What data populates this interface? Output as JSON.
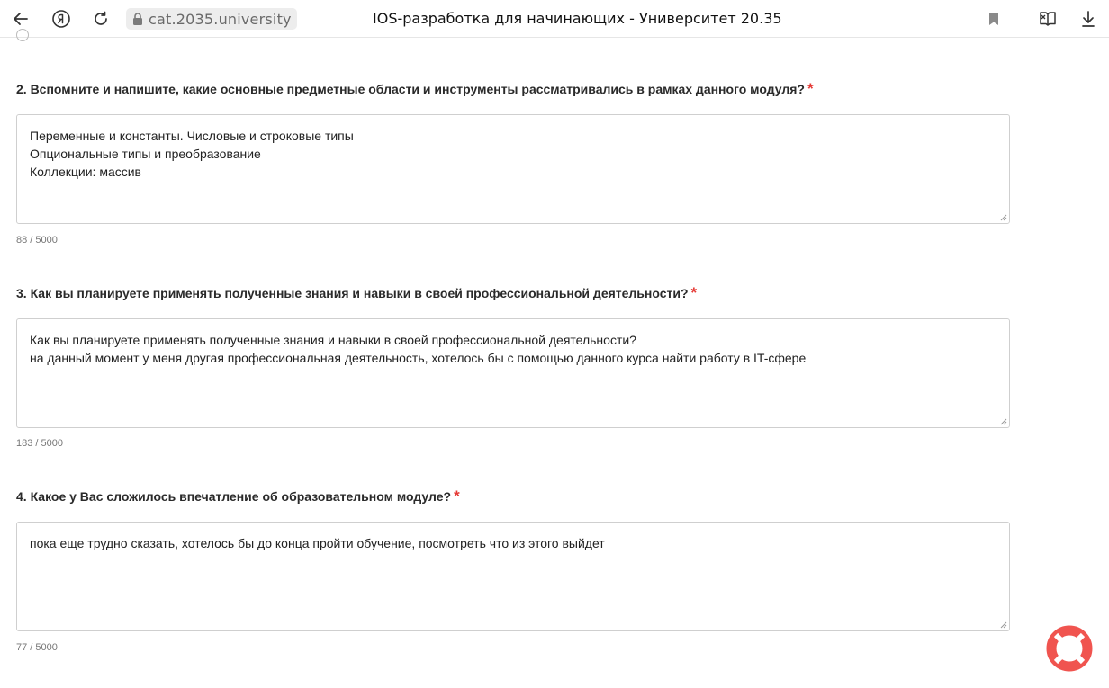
{
  "browser": {
    "url": "cat.2035.university",
    "title": "IOS-разработка для начинающих - Университет 20.35",
    "icons": [
      "back-arrow-icon",
      "yandex-icon",
      "reload-icon",
      "lock-icon",
      "bookmark-icon",
      "reader-mode-icon",
      "download-icon"
    ]
  },
  "questions": [
    {
      "title": "2. Вспомните и напишите, какие основные предметные области и инструменты рассматривались в рамках данного модуля?",
      "required_mark": "*",
      "answer_lines": [
        "Переменные и константы. Числовые и строковые типы",
        "Опциональные типы и преобразование",
        "Коллекции: массив"
      ],
      "counter": "88 / 5000"
    },
    {
      "title": "3. Как вы планируете применять полученные знания и навыки в своей профессиональной деятельности?",
      "required_mark": "*",
      "answer_lines": [
        "Как вы планируете применять полученные знания и навыки в своей профессиональной деятельности?",
        "на данный момент у меня другая профессиональная деятельность, хотелось бы с помощью данного курса найти работу в IT-сфере"
      ],
      "counter": "183 / 5000"
    },
    {
      "title": "4. Какое у Вас сложилось впечатление об образовательном модуле?",
      "required_mark": "*",
      "answer_lines": [
        "пока еще трудно сказать, хотелось бы до конца пройти обучение, посмотреть что из этого выйдет"
      ],
      "counter": "77 / 5000"
    }
  ],
  "colors": {
    "required": "#e53935",
    "help_button": "#f0544f"
  }
}
